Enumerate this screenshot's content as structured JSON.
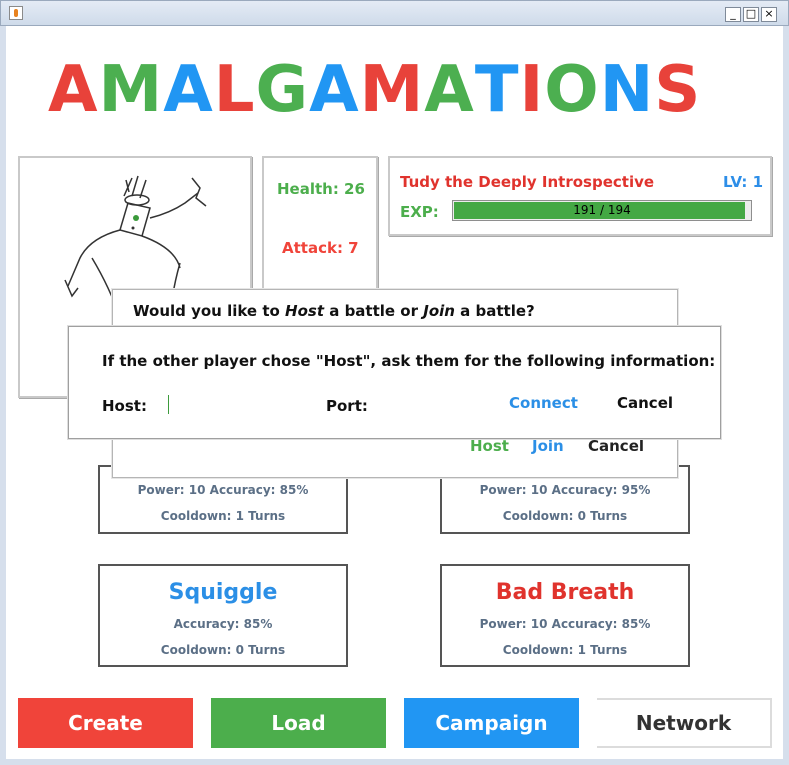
{
  "window": {
    "controls": [
      "_",
      "□",
      "×"
    ]
  },
  "logo": {
    "letters": [
      {
        "ch": "A",
        "color": "#e8423a"
      },
      {
        "ch": "M",
        "color": "#4caf50"
      },
      {
        "ch": "A",
        "color": "#2196f3"
      },
      {
        "ch": "L",
        "color": "#e8423a"
      },
      {
        "ch": "G",
        "color": "#4caf50"
      },
      {
        "ch": "A",
        "color": "#2196f3"
      },
      {
        "ch": "M",
        "color": "#e8423a"
      },
      {
        "ch": "A",
        "color": "#4caf50"
      },
      {
        "ch": "T",
        "color": "#2196f3"
      },
      {
        "ch": "I",
        "color": "#e8423a"
      },
      {
        "ch": "O",
        "color": "#4caf50"
      },
      {
        "ch": "N",
        "color": "#2196f3"
      },
      {
        "ch": "S",
        "color": "#e8423a"
      }
    ]
  },
  "character": {
    "health": "Health: 26",
    "attack": "Attack: 7",
    "name": "Tudy the Deeply Introspective",
    "level": "LV: 1",
    "exp_label": "EXP:",
    "exp_text": "191 / 194",
    "exp_fraction": 0.9845
  },
  "moves": [
    {
      "title": "",
      "line1": "Power: 10    Accuracy: 85%",
      "line2": "Cooldown: 1 Turns"
    },
    {
      "title": "",
      "line1": "Power: 10    Accuracy: 95%",
      "line2": "Cooldown: 0 Turns"
    },
    {
      "title": "Squiggle",
      "line1": "Accuracy: 85%",
      "line2": "Cooldown: 0 Turns",
      "color": "#2b8fe6"
    },
    {
      "title": "Bad Breath",
      "line1": "Power: 10    Accuracy: 85%",
      "line2": "Cooldown: 1 Turns",
      "color": "#e0332d"
    }
  ],
  "dialog_battle": {
    "question_prefix": "Would you like to ",
    "host_word": "Host",
    "middle": " a battle or ",
    "join_word": "Join",
    "suffix": " a battle?",
    "host_button": "Host",
    "join_button": "Join",
    "cancel_button": "Cancel"
  },
  "dialog_connect": {
    "message": "If the other player chose \"Host\", ask them for the following information:",
    "host_label": "Host:",
    "host_value": "",
    "port_label": "Port:",
    "port_value": "",
    "connect_button": "Connect",
    "cancel_button": "Cancel"
  },
  "bottom_nav": {
    "create": "Create",
    "load": "Load",
    "campaign": "Campaign",
    "network": "Network"
  },
  "colors": {
    "red": "#f0443a",
    "green": "#4cae4c",
    "blue": "#2196f3"
  }
}
